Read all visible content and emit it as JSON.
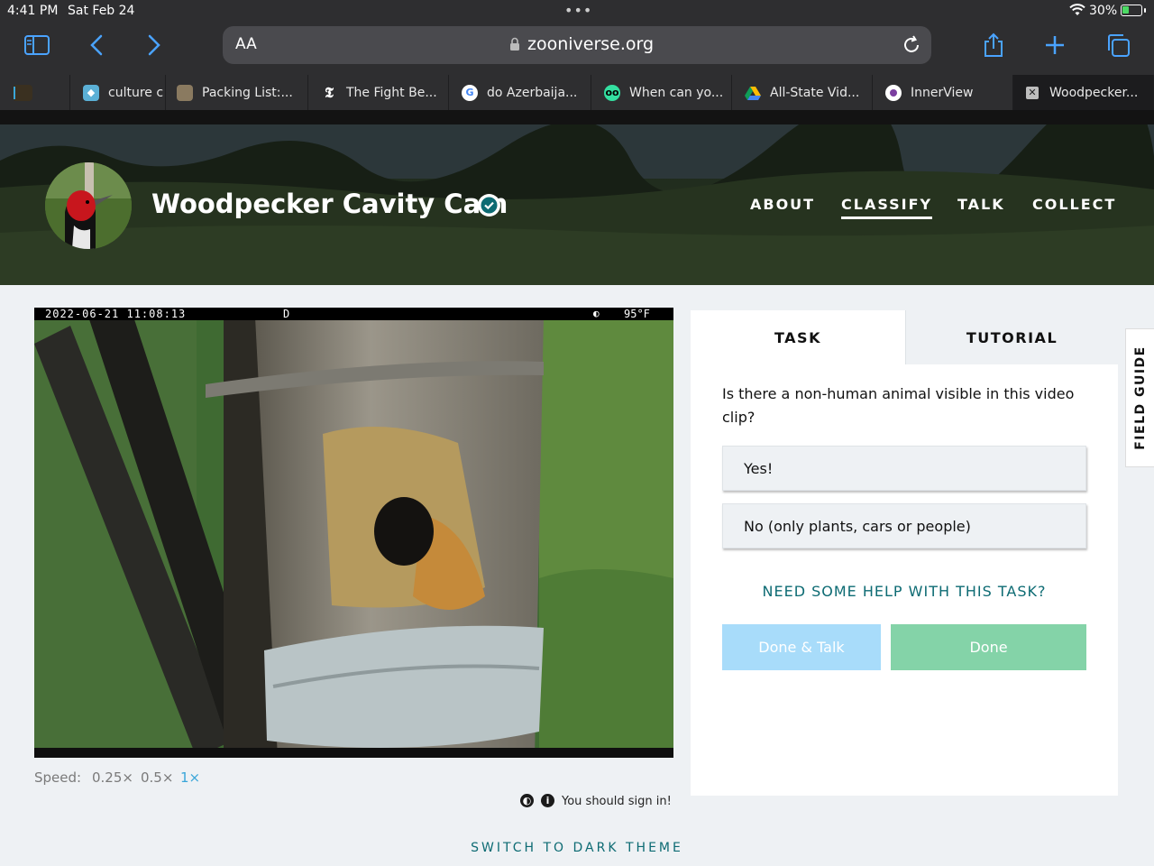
{
  "status_bar": {
    "time": "4:41 PM",
    "date": "Sat Feb 24",
    "battery": "30%"
  },
  "address_bar": {
    "text_size_label": "AA",
    "url": "zooniverse.org"
  },
  "tabs": [
    {
      "label": "",
      "icon": "museum-icon"
    },
    {
      "label": "culture c",
      "icon": "culture-icon"
    },
    {
      "label": "Packing List:...",
      "icon": "image-icon"
    },
    {
      "label": "The Fight Be...",
      "icon": "nyt-icon"
    },
    {
      "label": "do Azerbaija...",
      "icon": "google-icon"
    },
    {
      "label": "When can yo...",
      "icon": "tripadvisor-icon"
    },
    {
      "label": "All-State Vid...",
      "icon": "drive-icon"
    },
    {
      "label": "InnerView",
      "icon": "innerview-icon"
    },
    {
      "label": "Woodpecker...",
      "icon": "close-icon",
      "active": true
    }
  ],
  "project": {
    "title": "Woodpecker Cavity Cam",
    "nav": [
      "ABOUT",
      "CLASSIFY",
      "TALK",
      "COLLECT"
    ],
    "active_nav": "CLASSIFY"
  },
  "camera_overlay": {
    "timestamp": "2022-06-21 11:08:13",
    "mode": "D",
    "temperature": "95°F"
  },
  "playback": {
    "speed_label": "Speed:",
    "options": [
      "0.25×",
      "0.5×",
      "1×"
    ],
    "selected": "1×"
  },
  "sign_in_notice": "You should sign in!",
  "task_panel": {
    "tabs": [
      "TASK",
      "TUTORIAL"
    ],
    "active_tab": "TASK",
    "question": "Is there a non-human animal visible in this video clip?",
    "answers": [
      "Yes!",
      "No (only plants, cars or people)"
    ],
    "help_link": "NEED SOME HELP WITH THIS TASK?",
    "done_talk_label": "Done & Talk",
    "done_label": "Done"
  },
  "field_guide_label": "FIELD GUIDE",
  "footer_link": "SWITCH TO DARK THEME",
  "colors": {
    "accent_teal": "#0d6b73",
    "done_talk_bg": "#a8dcfa",
    "done_bg": "#84d3a8",
    "page_bg": "#eef1f4"
  }
}
